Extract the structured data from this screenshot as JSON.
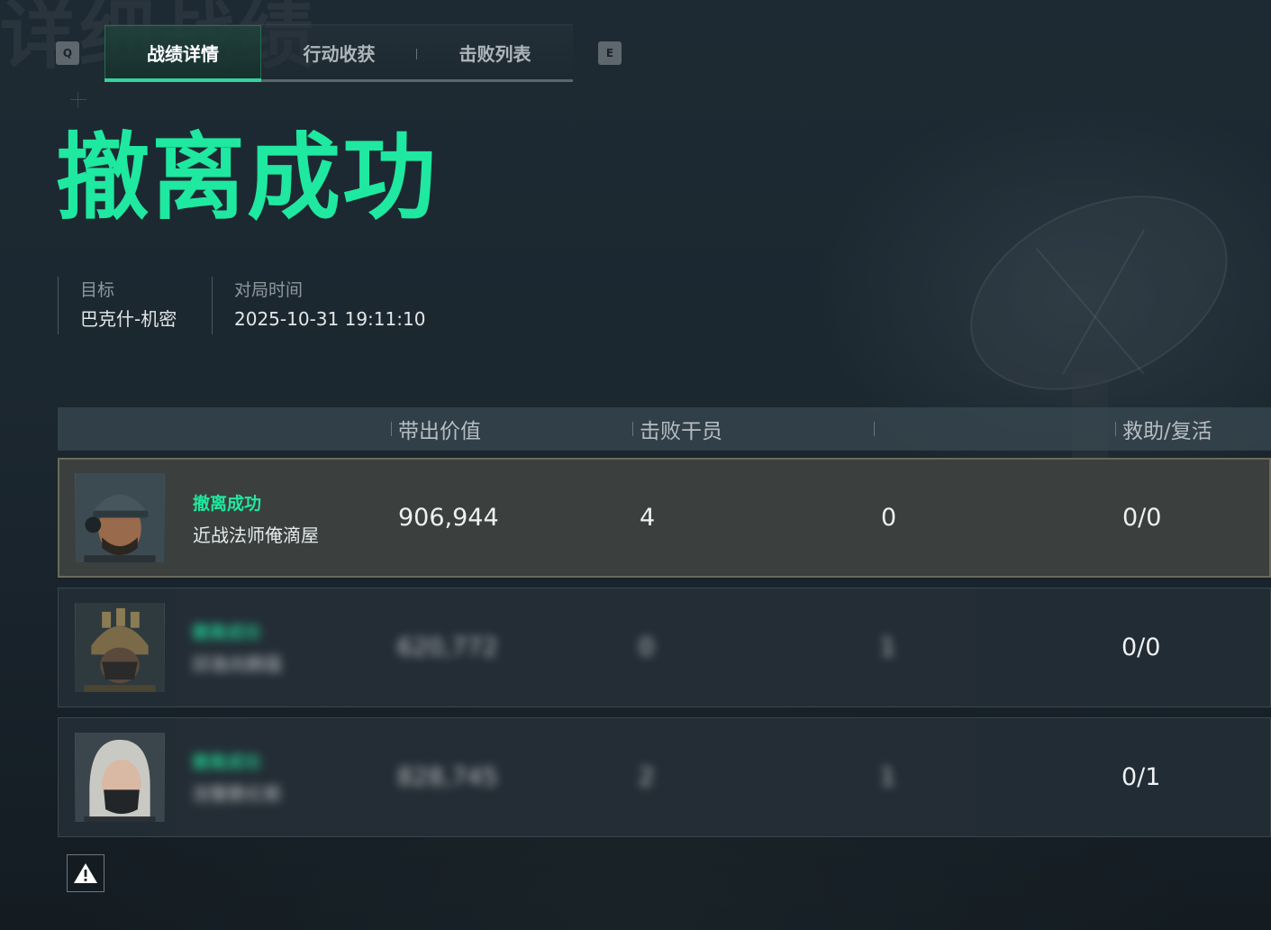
{
  "header": {
    "key_left": "Q",
    "key_right": "E",
    "tabs": [
      {
        "label": "战绩详情",
        "active": true
      },
      {
        "label": "行动收获",
        "active": false
      },
      {
        "label": "击败列表",
        "active": false
      }
    ]
  },
  "result_title": "撤离成功",
  "meta": {
    "target_label": "目标",
    "target_value": "巴克什-机密",
    "time_label": "对局时间",
    "time_value": "2025-10-31 19:11:10"
  },
  "table": {
    "headers": [
      "带出价值",
      "击败干员",
      "",
      "救助/复活"
    ],
    "rows": [
      {
        "status": "撤离成功",
        "name": "近战法师俺滴屋",
        "value": "906,944",
        "kills": "4",
        "col3": "0",
        "assist": "0/0",
        "obscured": false,
        "avatar": "male-operator-cap-headset"
      },
      {
        "status": "撤离成功",
        "name": "邱逸尚麒蕴",
        "value": "620,772",
        "kills": "0",
        "col3": "1",
        "assist": "0/0",
        "obscured": true,
        "avatar": "helmet-operator-mask"
      },
      {
        "status": "撤离成功",
        "name": "泡蟹鹏伦斯",
        "value": "828,745",
        "kills": "2",
        "col3": "1",
        "assist": "0/1",
        "obscured": true,
        "avatar": "female-operator-mask"
      }
    ]
  },
  "footer": {
    "warning_icon": "warning-icon"
  },
  "colors": {
    "accent": "#1fe8a0",
    "highlight_row_border": "#6a6a58"
  }
}
